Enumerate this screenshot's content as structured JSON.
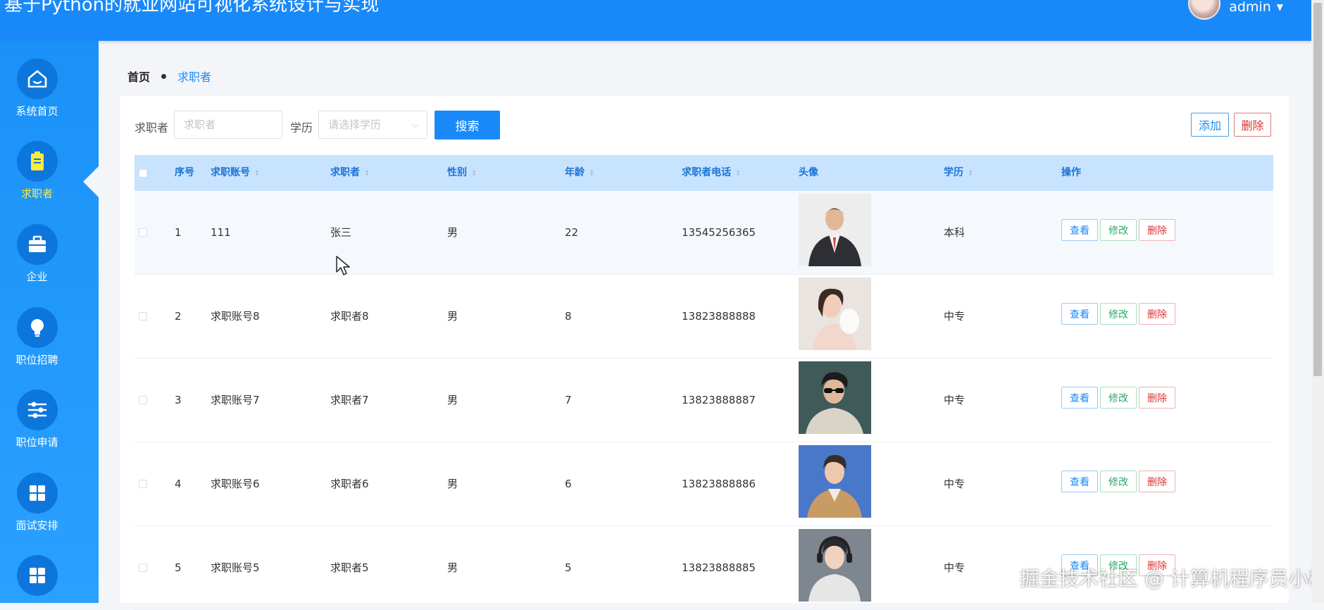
{
  "header": {
    "title": "基于Python的就业网站可视化系统设计与实现",
    "user": "admin",
    "caret": "▼"
  },
  "sidebar": {
    "items": [
      {
        "label": "系统首页",
        "icon": "home-icon"
      },
      {
        "label": "求职者",
        "icon": "clipboard-icon",
        "active": true
      },
      {
        "label": "企业",
        "icon": "briefcase-icon"
      },
      {
        "label": "职位招聘",
        "icon": "lightbulb-icon"
      },
      {
        "label": "职位申请",
        "icon": "sliders-icon"
      },
      {
        "label": "面试安排",
        "icon": "grid-icon"
      },
      {
        "label": "",
        "icon": "grid-icon"
      }
    ]
  },
  "breadcrumb": {
    "home": "首页",
    "current": "求职者"
  },
  "search": {
    "name_label": "求职者",
    "name_placeholder": "求职者",
    "edu_label": "学历",
    "edu_placeholder": "请选择学历",
    "button": "搜索"
  },
  "actions": {
    "add": "添加",
    "delete": "删除"
  },
  "table": {
    "columns": [
      "序号",
      "求职账号",
      "求职者",
      "性别",
      "年龄",
      "求职者电话",
      "头像",
      "学历",
      "操作"
    ],
    "row_buttons": {
      "view": "查看",
      "edit": "修改",
      "delete": "删除"
    },
    "rows": [
      {
        "no": "1",
        "account": "111",
        "name": "张三",
        "gender": "男",
        "age": "22",
        "phone": "13545256365",
        "edu": "本科"
      },
      {
        "no": "2",
        "account": "求职账号8",
        "name": "求职者8",
        "gender": "男",
        "age": "8",
        "phone": "13823888888",
        "edu": "中专"
      },
      {
        "no": "3",
        "account": "求职账号7",
        "name": "求职者7",
        "gender": "男",
        "age": "7",
        "phone": "13823888887",
        "edu": "中专"
      },
      {
        "no": "4",
        "account": "求职账号6",
        "name": "求职者6",
        "gender": "男",
        "age": "6",
        "phone": "13823888886",
        "edu": "中专"
      },
      {
        "no": "5",
        "account": "求职账号5",
        "name": "求职者5",
        "gender": "男",
        "age": "5",
        "phone": "13823888885",
        "edu": "中专"
      }
    ]
  },
  "watermark": "掘金技术社区 @ 计算机程序员小杨"
}
